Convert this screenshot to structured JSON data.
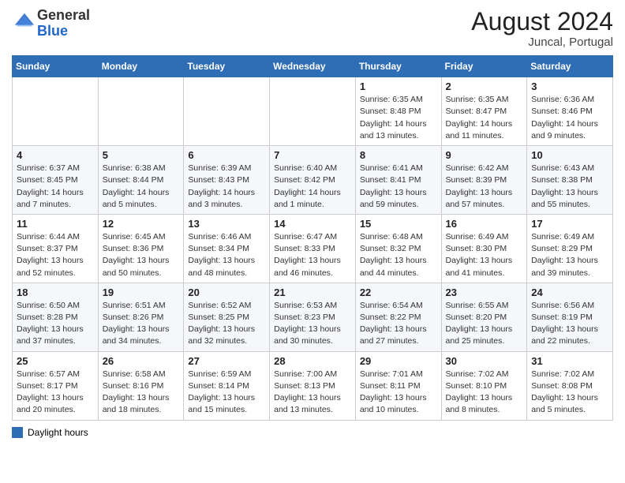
{
  "header": {
    "logo_general": "General",
    "logo_blue": "Blue",
    "month_year": "August 2024",
    "location": "Juncal, Portugal"
  },
  "columns": [
    "Sunday",
    "Monday",
    "Tuesday",
    "Wednesday",
    "Thursday",
    "Friday",
    "Saturday"
  ],
  "weeks": [
    [
      {
        "day": "",
        "info": ""
      },
      {
        "day": "",
        "info": ""
      },
      {
        "day": "",
        "info": ""
      },
      {
        "day": "",
        "info": ""
      },
      {
        "day": "1",
        "info": "Sunrise: 6:35 AM\nSunset: 8:48 PM\nDaylight: 14 hours and 13 minutes."
      },
      {
        "day": "2",
        "info": "Sunrise: 6:35 AM\nSunset: 8:47 PM\nDaylight: 14 hours and 11 minutes."
      },
      {
        "day": "3",
        "info": "Sunrise: 6:36 AM\nSunset: 8:46 PM\nDaylight: 14 hours and 9 minutes."
      }
    ],
    [
      {
        "day": "4",
        "info": "Sunrise: 6:37 AM\nSunset: 8:45 PM\nDaylight: 14 hours and 7 minutes."
      },
      {
        "day": "5",
        "info": "Sunrise: 6:38 AM\nSunset: 8:44 PM\nDaylight: 14 hours and 5 minutes."
      },
      {
        "day": "6",
        "info": "Sunrise: 6:39 AM\nSunset: 8:43 PM\nDaylight: 14 hours and 3 minutes."
      },
      {
        "day": "7",
        "info": "Sunrise: 6:40 AM\nSunset: 8:42 PM\nDaylight: 14 hours and 1 minute."
      },
      {
        "day": "8",
        "info": "Sunrise: 6:41 AM\nSunset: 8:41 PM\nDaylight: 13 hours and 59 minutes."
      },
      {
        "day": "9",
        "info": "Sunrise: 6:42 AM\nSunset: 8:39 PM\nDaylight: 13 hours and 57 minutes."
      },
      {
        "day": "10",
        "info": "Sunrise: 6:43 AM\nSunset: 8:38 PM\nDaylight: 13 hours and 55 minutes."
      }
    ],
    [
      {
        "day": "11",
        "info": "Sunrise: 6:44 AM\nSunset: 8:37 PM\nDaylight: 13 hours and 52 minutes."
      },
      {
        "day": "12",
        "info": "Sunrise: 6:45 AM\nSunset: 8:36 PM\nDaylight: 13 hours and 50 minutes."
      },
      {
        "day": "13",
        "info": "Sunrise: 6:46 AM\nSunset: 8:34 PM\nDaylight: 13 hours and 48 minutes."
      },
      {
        "day": "14",
        "info": "Sunrise: 6:47 AM\nSunset: 8:33 PM\nDaylight: 13 hours and 46 minutes."
      },
      {
        "day": "15",
        "info": "Sunrise: 6:48 AM\nSunset: 8:32 PM\nDaylight: 13 hours and 44 minutes."
      },
      {
        "day": "16",
        "info": "Sunrise: 6:49 AM\nSunset: 8:30 PM\nDaylight: 13 hours and 41 minutes."
      },
      {
        "day": "17",
        "info": "Sunrise: 6:49 AM\nSunset: 8:29 PM\nDaylight: 13 hours and 39 minutes."
      }
    ],
    [
      {
        "day": "18",
        "info": "Sunrise: 6:50 AM\nSunset: 8:28 PM\nDaylight: 13 hours and 37 minutes."
      },
      {
        "day": "19",
        "info": "Sunrise: 6:51 AM\nSunset: 8:26 PM\nDaylight: 13 hours and 34 minutes."
      },
      {
        "day": "20",
        "info": "Sunrise: 6:52 AM\nSunset: 8:25 PM\nDaylight: 13 hours and 32 minutes."
      },
      {
        "day": "21",
        "info": "Sunrise: 6:53 AM\nSunset: 8:23 PM\nDaylight: 13 hours and 30 minutes."
      },
      {
        "day": "22",
        "info": "Sunrise: 6:54 AM\nSunset: 8:22 PM\nDaylight: 13 hours and 27 minutes."
      },
      {
        "day": "23",
        "info": "Sunrise: 6:55 AM\nSunset: 8:20 PM\nDaylight: 13 hours and 25 minutes."
      },
      {
        "day": "24",
        "info": "Sunrise: 6:56 AM\nSunset: 8:19 PM\nDaylight: 13 hours and 22 minutes."
      }
    ],
    [
      {
        "day": "25",
        "info": "Sunrise: 6:57 AM\nSunset: 8:17 PM\nDaylight: 13 hours and 20 minutes."
      },
      {
        "day": "26",
        "info": "Sunrise: 6:58 AM\nSunset: 8:16 PM\nDaylight: 13 hours and 18 minutes."
      },
      {
        "day": "27",
        "info": "Sunrise: 6:59 AM\nSunset: 8:14 PM\nDaylight: 13 hours and 15 minutes."
      },
      {
        "day": "28",
        "info": "Sunrise: 7:00 AM\nSunset: 8:13 PM\nDaylight: 13 hours and 13 minutes."
      },
      {
        "day": "29",
        "info": "Sunrise: 7:01 AM\nSunset: 8:11 PM\nDaylight: 13 hours and 10 minutes."
      },
      {
        "day": "30",
        "info": "Sunrise: 7:02 AM\nSunset: 8:10 PM\nDaylight: 13 hours and 8 minutes."
      },
      {
        "day": "31",
        "info": "Sunrise: 7:02 AM\nSunset: 8:08 PM\nDaylight: 13 hours and 5 minutes."
      }
    ]
  ],
  "legend": {
    "label": "Daylight hours"
  }
}
